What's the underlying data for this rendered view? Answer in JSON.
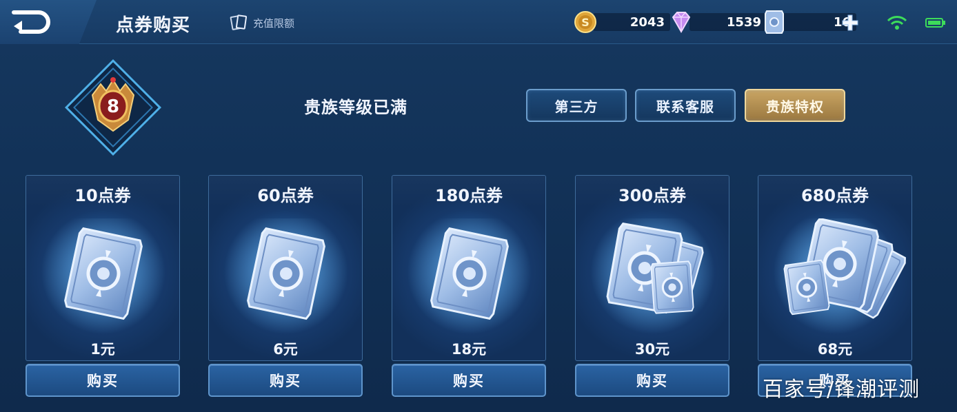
{
  "header": {
    "title": "点券购买",
    "recharge_label": "充值限额",
    "currencies": [
      {
        "name": "gold-coin",
        "value": "2043"
      },
      {
        "name": "diamond",
        "value": "1539"
      },
      {
        "name": "voucher",
        "value": "16"
      }
    ]
  },
  "noble": {
    "level": "8",
    "status": "贵族等级已满",
    "buttons": [
      "第三方",
      "联系客服",
      "贵族特权"
    ]
  },
  "products": [
    {
      "name": "10点券",
      "price": "1元",
      "buy_label": "购买"
    },
    {
      "name": "60点券",
      "price": "6元",
      "buy_label": "购买"
    },
    {
      "name": "180点券",
      "price": "18元",
      "buy_label": "购买"
    },
    {
      "name": "300点券",
      "price": "30元",
      "buy_label": "购买"
    },
    {
      "name": "680点券",
      "price": "68元",
      "buy_label": "购买"
    }
  ],
  "watermark": "百家号/锋潮评测",
  "colors": {
    "accent_gold": "#c9a563",
    "button_blue": "#2a63a3",
    "background": "#14355c",
    "wifi": "#3ddc5a"
  }
}
